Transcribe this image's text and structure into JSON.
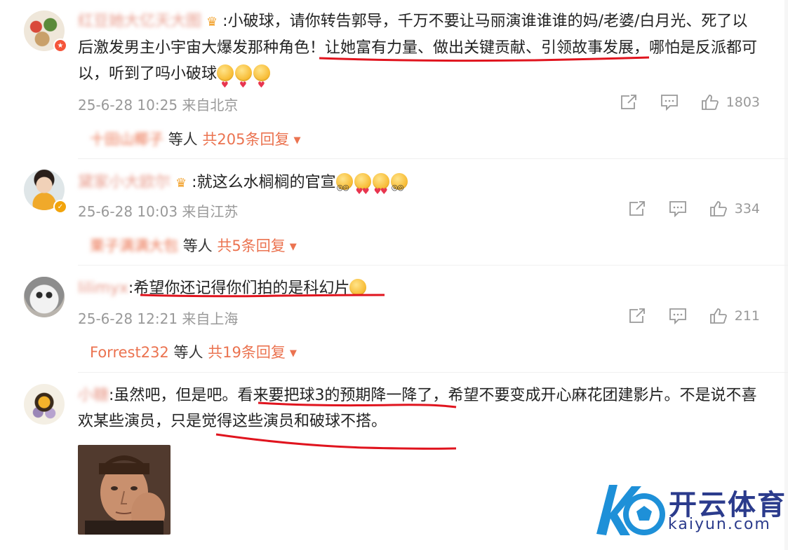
{
  "comments": [
    {
      "username": "红豆她大亿天大图",
      "text_intro": ":小破球，请你转告郭导，千万不要让马丽演谁谁谁的妈/老婆/白月光、死了以后激发男主小宇宙大爆发那种角色！",
      "text_underlined": "让她富有力量、做出关键贡献、引领故事发展，",
      "text_outro": "哪怕是反派都可以，听到了吗小破球",
      "time": "25-6-28 10:25",
      "location": "来自北京",
      "likes": "1803",
      "reply_users": "十田山椰子",
      "reply_suffix": "等人",
      "reply_count": "共205条回复"
    },
    {
      "username": "黛家小大欧尔",
      "text": ":就这么水榈榈的官宣",
      "time": "25-6-28 10:03",
      "location": "来自江苏",
      "likes": "334",
      "reply_users": "栗子满满大包",
      "reply_suffix": "等人",
      "reply_count": "共5条回复"
    },
    {
      "username": "lilimyx",
      "text": ":希望你还记得你们拍的是科幻片",
      "time": "25-6-28 12:21",
      "location": "来自上海",
      "likes": "211",
      "reply_users": "Forrest232",
      "reply_suffix": "等人",
      "reply_count": "共19条回复"
    },
    {
      "username": "小糖",
      "text_intro": ":虽然吧，但是吧。",
      "text_underlined": "看来要把球3的预期降一降了，",
      "text_mid": "希望不要变成开心麻花团建影片。不是说不喜欢某些演员，",
      "text_underlined2": "只是觉得这些演员和破球不搭。"
    }
  ],
  "logo": {
    "cn": "开云体育",
    "en": "kaiyun.com"
  },
  "colors": {
    "accent": "#eb7350",
    "underline": "#e0141e",
    "meta": "#999999",
    "logo": "#2b3b8c"
  },
  "icons": [
    "share-icon",
    "comment-icon",
    "like-icon",
    "caret-down-icon",
    "crown-icon",
    "verified-icon"
  ]
}
